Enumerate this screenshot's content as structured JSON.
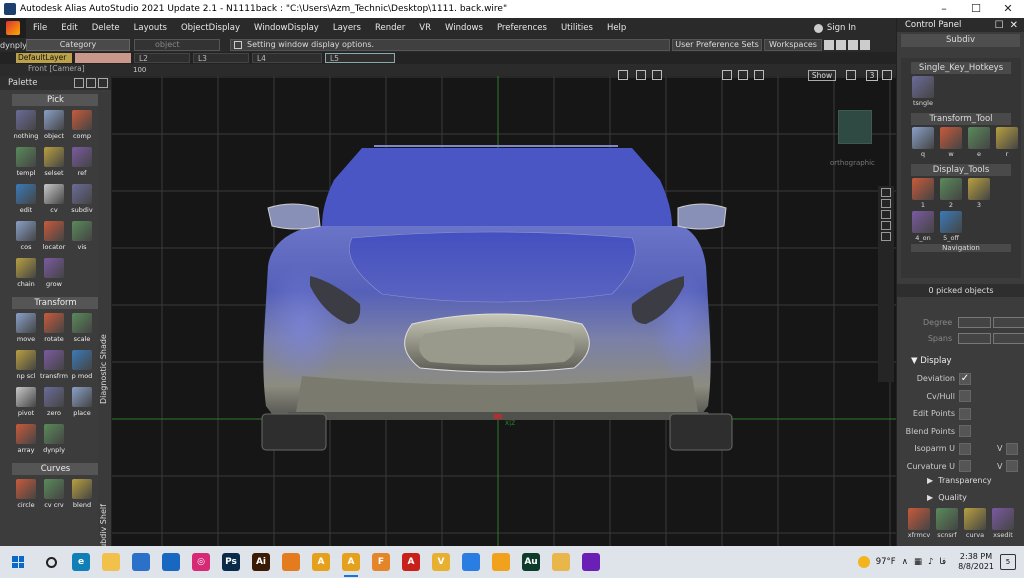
{
  "window": {
    "title": "Autodesk Alias AutoStudio 2021 Update 2.1   -  N1111back : \"C:\\Users\\Azm_Technic\\Desktop\\1111. back.wire\""
  },
  "menubar": {
    "items": [
      "File",
      "Edit",
      "Delete",
      "Layouts",
      "ObjectDisplay",
      "WindowDisplay",
      "Layers",
      "Render",
      "VR",
      "Windows",
      "Preferences",
      "Utilities",
      "Help"
    ],
    "sign_in": "Sign In"
  },
  "toolbar": {
    "dynply": "dynply",
    "category": "Category",
    "object_placeholder": "object",
    "status_message": "Setting window display options.",
    "user_pref_sets": "User Preference Sets",
    "workspaces": "Workspaces"
  },
  "layers": {
    "default": "DefaultLayer",
    "items": [
      "L2",
      "L3",
      "L4",
      "L5"
    ]
  },
  "viewport": {
    "tab_title": "Front [Camera]",
    "zoom": "100",
    "show_label": "Show",
    "mode_number": "3",
    "view_label": "orthographic",
    "axis_mark": "X|Z"
  },
  "palette": {
    "title": "Palette",
    "vertical_labels": [
      "Diagnostic Shade",
      "Subdiv Shelf"
    ],
    "sections": [
      {
        "title": "Pick",
        "tools": [
          {
            "label": "nothing",
            "icon": "pick-nothing-icon"
          },
          {
            "label": "object",
            "icon": "pick-object-icon"
          },
          {
            "label": "comp",
            "icon": "pick-component-icon"
          },
          {
            "label": "templ",
            "icon": "pick-template-icon"
          },
          {
            "label": "selset",
            "icon": "selection-set-icon"
          },
          {
            "label": "ref",
            "icon": "reference-icon"
          },
          {
            "label": "edit",
            "icon": "edit-icon"
          },
          {
            "label": "cv",
            "icon": "pick-cv-icon"
          },
          {
            "label": "subdiv",
            "icon": "pick-subdiv-icon"
          },
          {
            "label": "cos",
            "icon": "cos-icon"
          },
          {
            "label": "locator",
            "icon": "locator-icon"
          },
          {
            "label": "vis",
            "icon": "visible-icon"
          },
          {
            "label": "chain",
            "icon": "chain-icon"
          },
          {
            "label": "grow",
            "icon": "grow-icon"
          }
        ]
      },
      {
        "title": "Transform",
        "tools": [
          {
            "label": "move",
            "icon": "move-icon"
          },
          {
            "label": "rotate",
            "icon": "rotate-icon"
          },
          {
            "label": "scale",
            "icon": "scale-icon"
          },
          {
            "label": "np scl",
            "icon": "nonprop-scale-icon"
          },
          {
            "label": "transfrm",
            "icon": "transform-icon"
          },
          {
            "label": "p mod",
            "icon": "proportional-modify-icon"
          },
          {
            "label": "pivot",
            "icon": "pivot-icon"
          },
          {
            "label": "zero",
            "icon": "zero-icon"
          },
          {
            "label": "place",
            "icon": "place-icon"
          },
          {
            "label": "array",
            "icon": "array-icon"
          },
          {
            "label": "dynply",
            "icon": "dynamic-placement-icon"
          }
        ]
      },
      {
        "title": "Curves",
        "tools": [
          {
            "label": "circle",
            "icon": "circle-icon"
          },
          {
            "label": "cv crv",
            "icon": "cv-curve-icon"
          },
          {
            "label": "blend",
            "icon": "blend-curve-icon"
          }
        ]
      }
    ]
  },
  "control_panel": {
    "title": "Control Panel",
    "mode": "Subdiv",
    "shelves": [
      {
        "title": "Single_Key_Hotkeys",
        "tools": [
          {
            "label": "tsngle",
            "icon": "toggle-single-icon"
          }
        ]
      },
      {
        "title": "Transform_Tool",
        "tools": [
          {
            "label": "q",
            "icon": "q-tool-icon"
          },
          {
            "label": "w",
            "icon": "w-tool-icon"
          },
          {
            "label": "e",
            "icon": "e-tool-icon"
          },
          {
            "label": "r",
            "icon": "r-tool-icon"
          }
        ]
      },
      {
        "title": "Display_Tools",
        "tools": [
          {
            "label": "1",
            "icon": "display-1-icon"
          },
          {
            "label": "2",
            "icon": "display-2-icon"
          },
          {
            "label": "3",
            "icon": "display-3-icon"
          },
          {
            "label": "4_on",
            "icon": "display-4-on-icon"
          },
          {
            "label": "5_off",
            "icon": "display-5-off-icon"
          }
        ]
      }
    ],
    "navigation_label": "Navigation",
    "picked_objects": "0 picked objects",
    "degree_label": "Degree",
    "spans_label": "Spans",
    "display_header": "Display",
    "display_options": [
      {
        "label": "Deviation",
        "checked": true
      },
      {
        "label": "Cv/Hull",
        "checked": false
      },
      {
        "label": "Edit Points",
        "checked": false
      },
      {
        "label": "Blend Points",
        "checked": false
      },
      {
        "label": "Isoparm U",
        "checked": false,
        "v_label": "V"
      },
      {
        "label": "Curvature U",
        "checked": false,
        "v_label": "V"
      }
    ],
    "collapsed": [
      "Transparency",
      "Quality"
    ],
    "bottom_tools": [
      {
        "label": "xfrmcv",
        "icon": "xform-cv-icon"
      },
      {
        "label": "scnsrf",
        "icon": "scan-surface-icon"
      },
      {
        "label": "curva",
        "icon": "curvature-icon"
      },
      {
        "label": "xsedit",
        "icon": "cross-section-edit-icon"
      }
    ]
  },
  "taskbar": {
    "apps": [
      {
        "name": "search-icon",
        "label": "",
        "color": "#dfe3ea"
      },
      {
        "name": "edge-icon",
        "label": "e",
        "color": "#0f7fb6"
      },
      {
        "name": "file-explorer-icon",
        "label": "",
        "color": "#f2c14b"
      },
      {
        "name": "store-icon",
        "label": "",
        "color": "#2b70c9"
      },
      {
        "name": "mail-icon",
        "label": "",
        "color": "#1867c0"
      },
      {
        "name": "instagram-icon",
        "label": "◎",
        "color": "#d62976"
      },
      {
        "name": "photoshop-icon",
        "label": "Ps",
        "color": "#0b2a4a"
      },
      {
        "name": "illustrator-icon",
        "label": "Ai",
        "color": "#3a1b06"
      },
      {
        "name": "blender-icon",
        "label": "",
        "color": "#e57b1f"
      },
      {
        "name": "autodesk-alias-icon",
        "label": "A",
        "color": "#e5a11c"
      },
      {
        "name": "autodesk-alias-active-icon",
        "label": "A",
        "color": "#e5a11c",
        "active": true
      },
      {
        "name": "fusion-icon",
        "label": "F",
        "color": "#e5852a"
      },
      {
        "name": "autocad-icon",
        "label": "A",
        "color": "#c8201a"
      },
      {
        "name": "vred-icon",
        "label": "V",
        "color": "#e8b030"
      },
      {
        "name": "chrome-icon",
        "label": "",
        "color": "#2a7de1"
      },
      {
        "name": "fl-studio-icon",
        "label": "",
        "color": "#f1a11c"
      },
      {
        "name": "audition-icon",
        "label": "Au",
        "color": "#0d3b2a"
      },
      {
        "name": "keyshot-icon",
        "label": "",
        "color": "#e8b64a"
      },
      {
        "name": "media-encoder-icon",
        "label": "",
        "color": "#6a1fb5"
      }
    ],
    "weather": "97°F",
    "lang": "فا",
    "time": "2:38 PM",
    "date": "8/8/2021",
    "notifications": "5"
  }
}
